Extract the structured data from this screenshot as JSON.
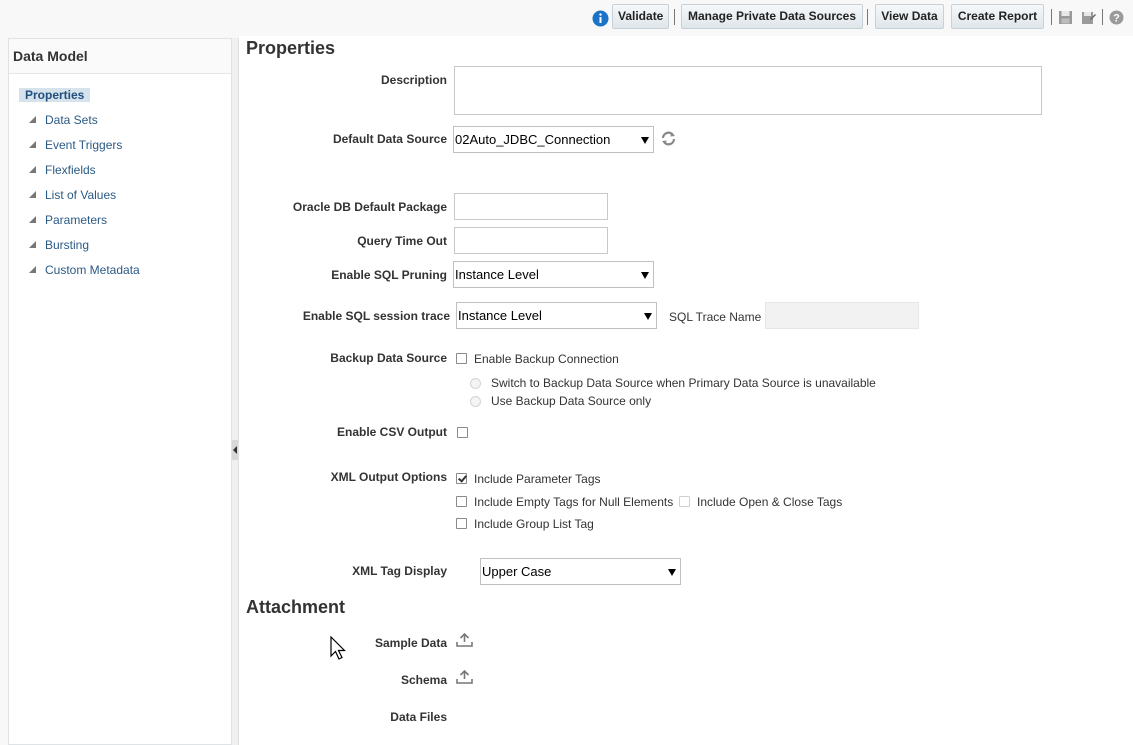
{
  "toolbar": {
    "validate": "Validate",
    "manage_sources": "Manage Private Data Sources",
    "view_data": "View Data",
    "create_report": "Create Report"
  },
  "sidebar": {
    "title": "Data Model",
    "selected": "Properties",
    "items": [
      "Data Sets",
      "Event Triggers",
      "Flexfields",
      "List of Values",
      "Parameters",
      "Bursting",
      "Custom Metadata"
    ]
  },
  "properties": {
    "heading": "Properties",
    "description_label": "Description",
    "description_value": "",
    "default_ds_label": "Default Data Source",
    "default_ds_value": "02Auto_JDBC_Connection",
    "oracle_pkg_label": "Oracle DB Default Package",
    "oracle_pkg_value": "",
    "query_timeout_label": "Query Time Out",
    "query_timeout_value": "",
    "sql_pruning_label": "Enable SQL Pruning",
    "sql_pruning_value": "Instance Level",
    "sql_trace_label": "Enable SQL session trace",
    "sql_trace_value": "Instance Level",
    "sql_trace_name_label": "SQL Trace Name",
    "sql_trace_name_value": "",
    "backup_label": "Backup Data Source",
    "backup_enable": "Enable Backup Connection",
    "backup_switch": "Switch to Backup Data Source when Primary Data Source is unavailable",
    "backup_only": "Use Backup Data Source only",
    "csv_label": "Enable CSV Output",
    "xml_options_label": "XML Output Options",
    "xml_include_param": "Include Parameter Tags",
    "xml_include_empty": "Include Empty Tags for Null Elements",
    "xml_include_openclose": "Include Open & Close Tags",
    "xml_include_group": "Include Group List Tag",
    "xml_tag_display_label": "XML Tag Display",
    "xml_tag_display_value": "Upper Case"
  },
  "attachment": {
    "heading": "Attachment",
    "sample_data": "Sample Data",
    "schema": "Schema",
    "data_files": "Data Files"
  },
  "colors": {
    "accent": "#2b5a85",
    "info_icon": "#1a73c8"
  }
}
